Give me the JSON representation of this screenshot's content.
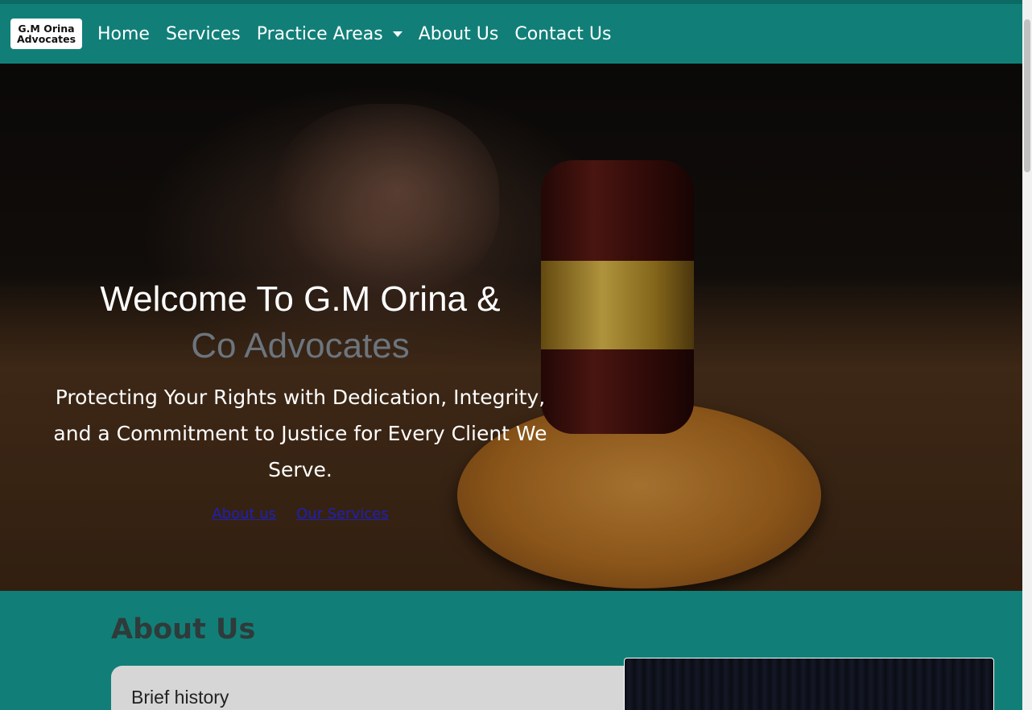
{
  "brand": {
    "line1": "G.M Orina",
    "line2": "Advocates"
  },
  "nav": {
    "items": [
      "Home",
      "Services",
      "Practice Areas",
      "About Us",
      "Contact Us"
    ]
  },
  "hero": {
    "title_main": "Welcome To G.M Orina &",
    "title_accent": "Co Advocates",
    "subtitle": "Protecting Your Rights with Dedication, Integrity, and a Commitment to Justice for Every Client We Serve.",
    "link_about": "About us",
    "link_services": "Our Services"
  },
  "about": {
    "heading": "About Us",
    "card_title": "Brief history"
  },
  "colors": {
    "nav_bg": "#117f78",
    "accent_text": "#6c757d",
    "link": "#1f1fb8"
  }
}
